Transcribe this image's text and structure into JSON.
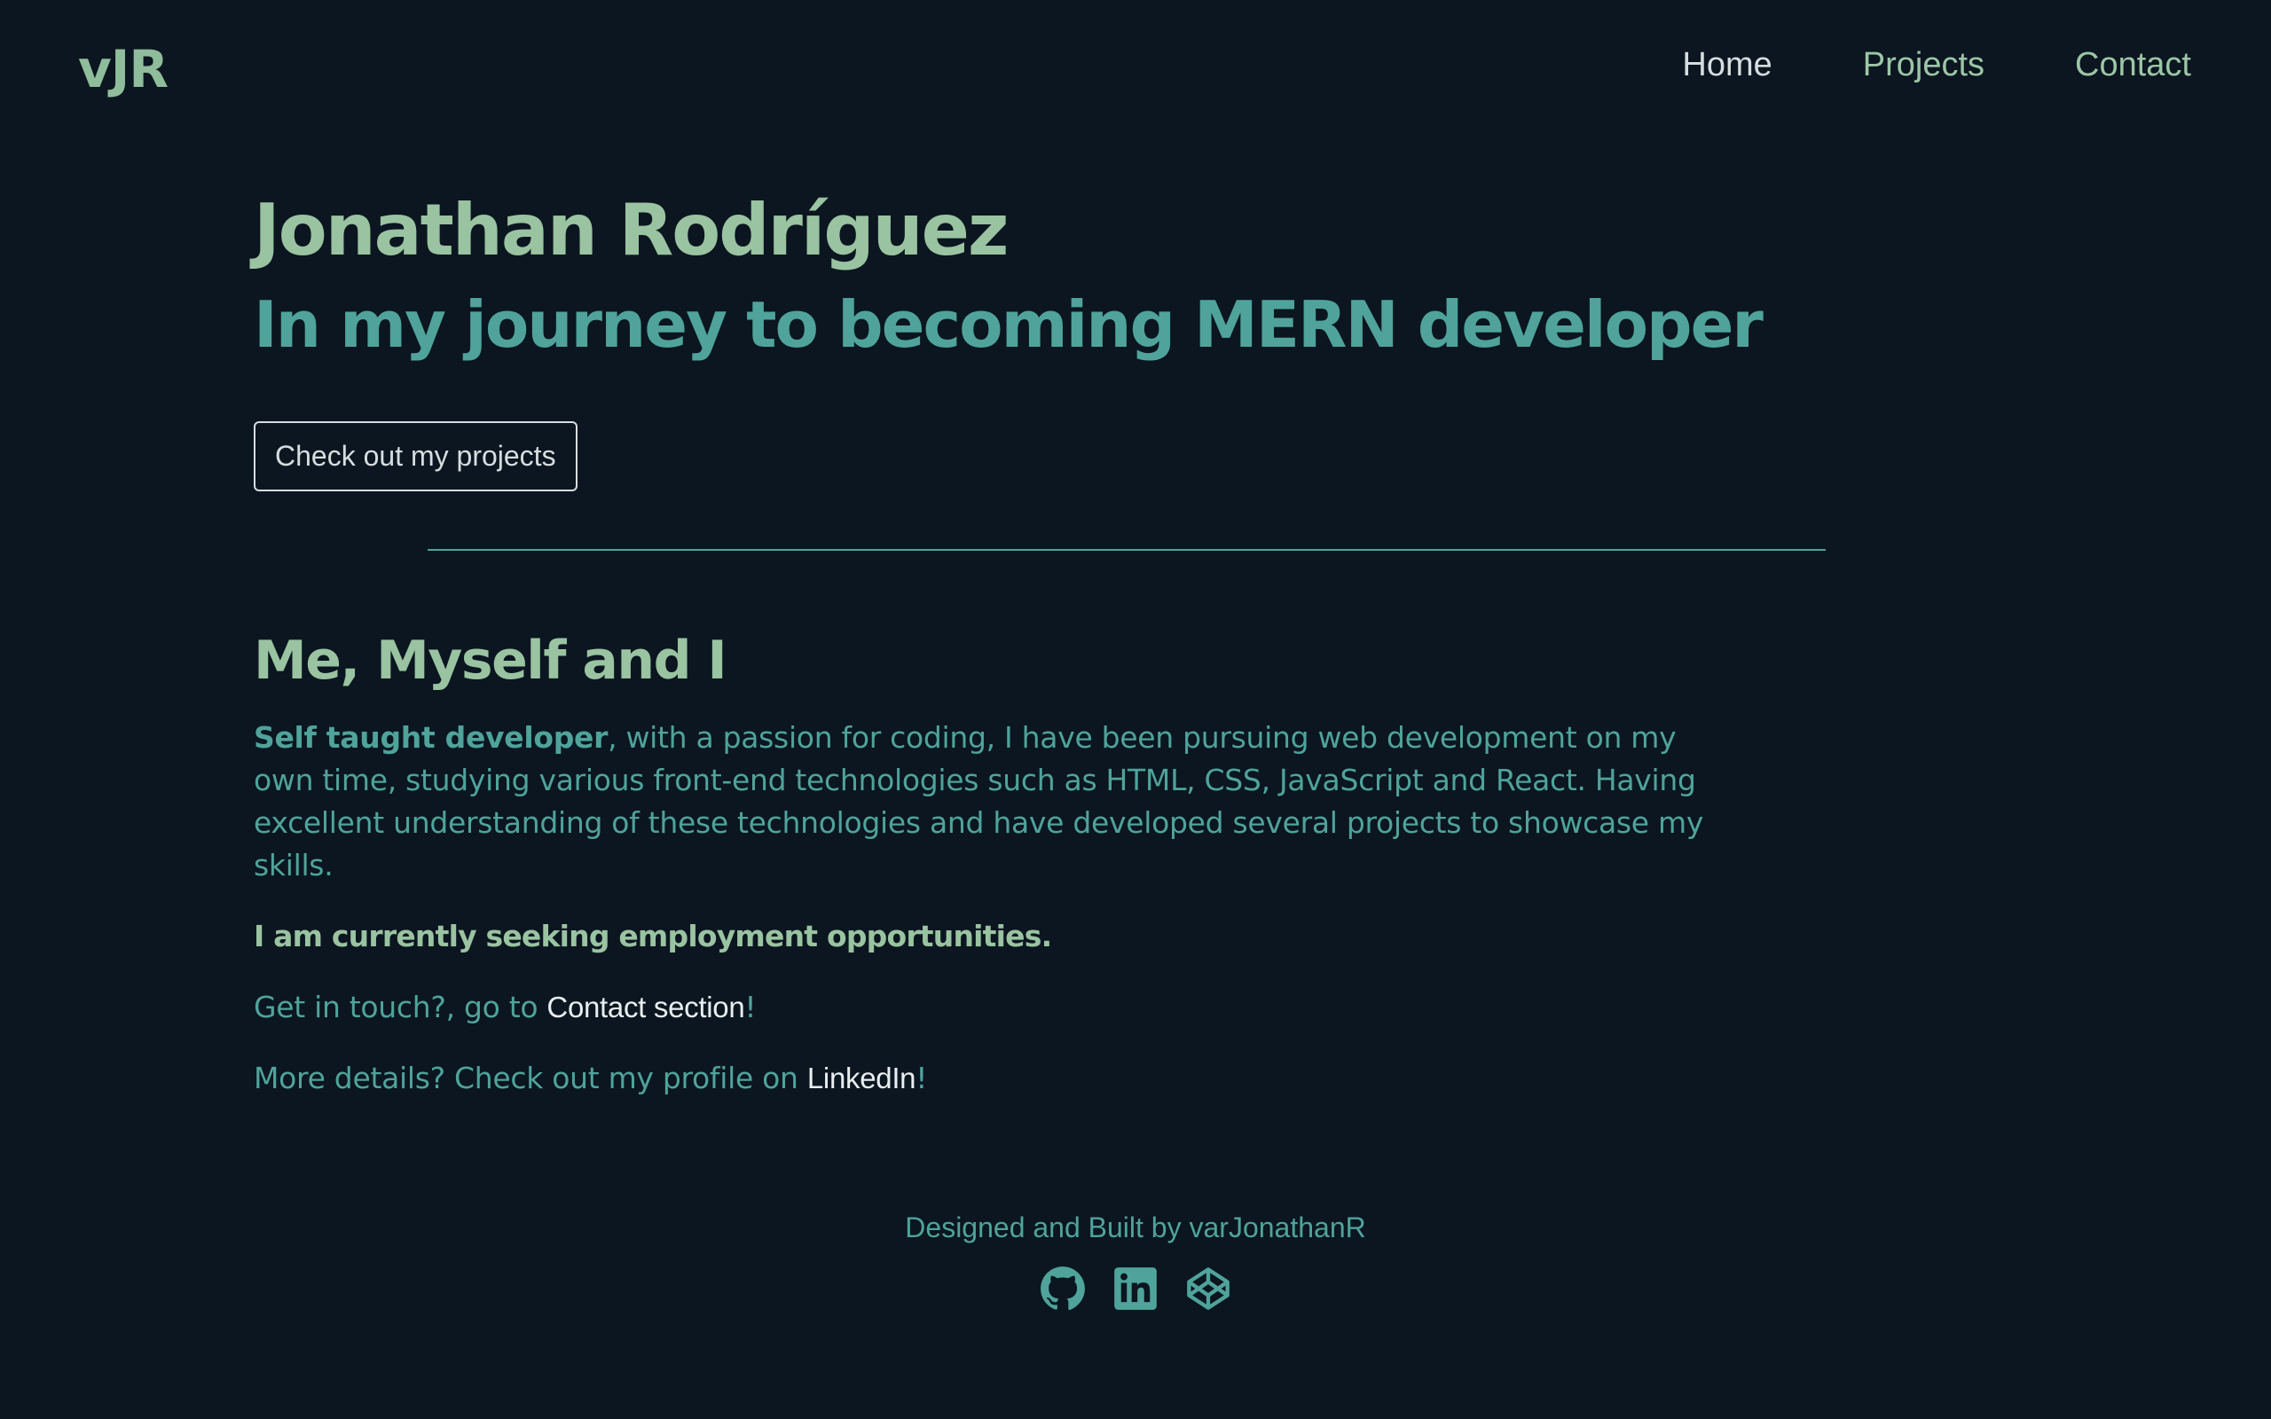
{
  "colors": {
    "background": "#0b1620",
    "accent_green": "#9ac3a1",
    "accent_teal": "#4fa39a",
    "light_text": "#d6dde0"
  },
  "navbar": {
    "logo": "vJR",
    "links": [
      {
        "label": "Home"
      },
      {
        "label": "Projects"
      },
      {
        "label": "Contact"
      }
    ]
  },
  "hero": {
    "name": "Jonathan Rodríguez",
    "tagline": "In my journey to becoming MERN developer",
    "button_label": "Check out my projects"
  },
  "about": {
    "title": "Me, Myself and I",
    "intro_strong": "Self taught developer",
    "intro_rest": ", with a passion for coding, I have been pursuing web development on my own time, studying various front-end technologies such as HTML, CSS, JavaScript and React. Having excellent understanding of these technologies and have developed several projects to showcase my skills.",
    "seeking": "I am currently seeking employment opportunities.",
    "contact_prefix": "Get in touch?, go to ",
    "contact_link": "Contact section",
    "contact_suffix": "!",
    "linkedin_prefix": "More details? Check out my profile on ",
    "linkedin_link": "LinkedIn",
    "linkedin_suffix": "!"
  },
  "footer": {
    "credit": "Designed and Built by varJonathanR",
    "icons": [
      "github-icon",
      "linkedin-icon",
      "codepen-icon"
    ]
  }
}
